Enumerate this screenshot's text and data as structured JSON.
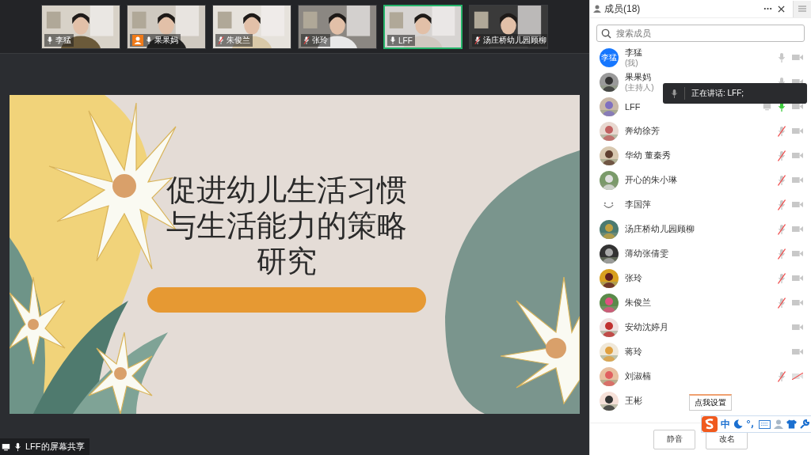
{
  "video_strip": [
    {
      "name": "李猛",
      "muted": false,
      "host": false,
      "selected": false
    },
    {
      "name": "果果妈",
      "muted": false,
      "host": true,
      "selected": false
    },
    {
      "name": "朱俊兰",
      "muted": true,
      "host": false,
      "selected": false
    },
    {
      "name": "张玲",
      "muted": true,
      "host": false,
      "selected": false
    },
    {
      "name": "LFF",
      "muted": false,
      "host": false,
      "selected": true
    },
    {
      "name": "汤庄桥幼儿园顾柳",
      "muted": true,
      "host": false,
      "selected": false
    }
  ],
  "slide": {
    "title_lines": [
      "促进幼儿生活习惯",
      "与生活能力的策略",
      "研究"
    ]
  },
  "share_label": "LFF的屏幕共享",
  "members_panel": {
    "title": "成员(18)",
    "search": {
      "placeholder": "搜索成员"
    },
    "members": [
      {
        "name": "李猛",
        "role": "(我)",
        "avatar": {
          "kind": "text",
          "text": "李猛"
        },
        "has_mic": true,
        "muted": false,
        "speaking": false,
        "has_camera": true,
        "camera_blocked": false,
        "sharing": false
      },
      {
        "name": "果果妈",
        "role": "(主持人)",
        "has_mic": true,
        "muted": false,
        "speaking": false,
        "has_camera": true,
        "camera_blocked": false,
        "sharing": false
      },
      {
        "name": "LFF",
        "has_mic": true,
        "muted": false,
        "speaking": true,
        "has_camera": true,
        "camera_blocked": false,
        "sharing": true
      },
      {
        "name": "奔幼徐芳",
        "has_mic": true,
        "muted": true,
        "speaking": false,
        "has_camera": true,
        "camera_blocked": false,
        "sharing": false
      },
      {
        "name": "华幼 董秦秀",
        "has_mic": true,
        "muted": true,
        "speaking": false,
        "has_camera": true,
        "camera_blocked": false,
        "sharing": false
      },
      {
        "name": "开心的朱小琳",
        "has_mic": true,
        "muted": true,
        "speaking": false,
        "has_camera": true,
        "camera_blocked": false,
        "sharing": false
      },
      {
        "name": "李国萍",
        "avatar": {
          "kind": "smiley"
        },
        "has_mic": true,
        "muted": true,
        "speaking": false,
        "has_camera": true,
        "camera_blocked": false,
        "sharing": false
      },
      {
        "name": "汤庄桥幼儿园顾柳",
        "has_mic": true,
        "muted": true,
        "speaking": false,
        "has_camera": true,
        "camera_blocked": false,
        "sharing": false
      },
      {
        "name": "薄幼张倩雯",
        "has_mic": true,
        "muted": true,
        "speaking": false,
        "has_camera": true,
        "camera_blocked": false,
        "sharing": false
      },
      {
        "name": "张玲",
        "has_mic": true,
        "muted": true,
        "speaking": false,
        "has_camera": true,
        "camera_blocked": false,
        "sharing": false
      },
      {
        "name": "朱俊兰",
        "has_mic": true,
        "muted": true,
        "speaking": false,
        "has_camera": true,
        "camera_blocked": false,
        "sharing": false
      },
      {
        "name": "安幼沈婷月",
        "has_mic": false,
        "has_camera": true,
        "camera_blocked": false,
        "sharing": false
      },
      {
        "name": "蒋玲",
        "has_mic": false,
        "has_camera": true,
        "camera_blocked": false,
        "sharing": false
      },
      {
        "name": "刘淑楠",
        "has_mic": true,
        "muted": true,
        "speaking": false,
        "has_camera": true,
        "camera_blocked": true,
        "sharing": false
      },
      {
        "name": "王彬",
        "has_mic": false,
        "has_camera": false,
        "sharing": false
      }
    ],
    "speaking_tooltip": {
      "text": "正在讲话: LFF;"
    },
    "buttons": [
      "静音",
      "改名"
    ]
  },
  "ime_toolbar": {
    "label": "中",
    "tooltip": "点我设置"
  }
}
